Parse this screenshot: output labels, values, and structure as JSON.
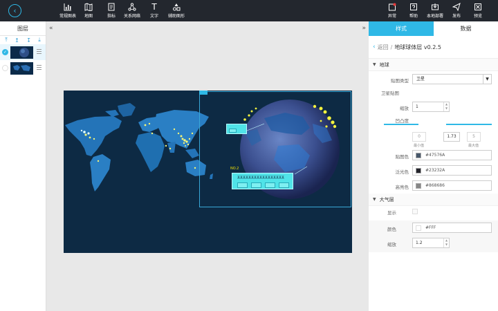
{
  "toolbar": {
    "items": [
      {
        "label": "常规图表",
        "icon": "bar-chart-icon"
      },
      {
        "label": "地图",
        "icon": "map-icon"
      },
      {
        "label": "指标",
        "icon": "indicator-icon"
      },
      {
        "label": "关系网络",
        "icon": "network-icon"
      },
      {
        "label": "文字",
        "icon": "text-icon"
      },
      {
        "label": "辅助图形",
        "icon": "shapes-icon"
      }
    ],
    "right_items": [
      {
        "label": "异常",
        "icon": "warning-icon"
      },
      {
        "label": "帮助",
        "icon": "help-icon"
      },
      {
        "label": "本地部署",
        "icon": "deploy-icon"
      },
      {
        "label": "发布",
        "icon": "publish-icon"
      },
      {
        "label": "预览",
        "icon": "preview-icon"
      }
    ]
  },
  "layers": {
    "title": "图层"
  },
  "canvas": {
    "popup_label": "NO.2",
    "popup_text": "某某某某某某某某某某某某某某某某某"
  },
  "props": {
    "tabs": [
      "样式",
      "数据"
    ],
    "crumb_back": "返回",
    "crumb_sep": "/",
    "crumb_title": "地球球体层 v0.2.5",
    "sections": {
      "globe": "地球",
      "atmosphere": "大气层"
    },
    "map_type_label": "贴图类型",
    "map_type_value": "卫星",
    "satellite_map_label": "卫星贴图",
    "zoom_label": "缩放",
    "zoom_value": "1",
    "bump_label": "凹凸度",
    "bump_min": "0",
    "bump_value": "1.73",
    "bump_max": "5",
    "bump_min_label": "最小值",
    "bump_max_label": "最大值",
    "map_color_label": "贴图色",
    "map_color_value": "#47576A",
    "glow_color_label": "泛光色",
    "glow_color_value": "#23232A",
    "highlight_color_label": "高亮色",
    "highlight_color_value": "#868686",
    "show_label": "显示",
    "color_label": "颜色",
    "color_value": "#FFF",
    "atm_zoom_label": "缩放",
    "atm_zoom_value": "1.2"
  }
}
